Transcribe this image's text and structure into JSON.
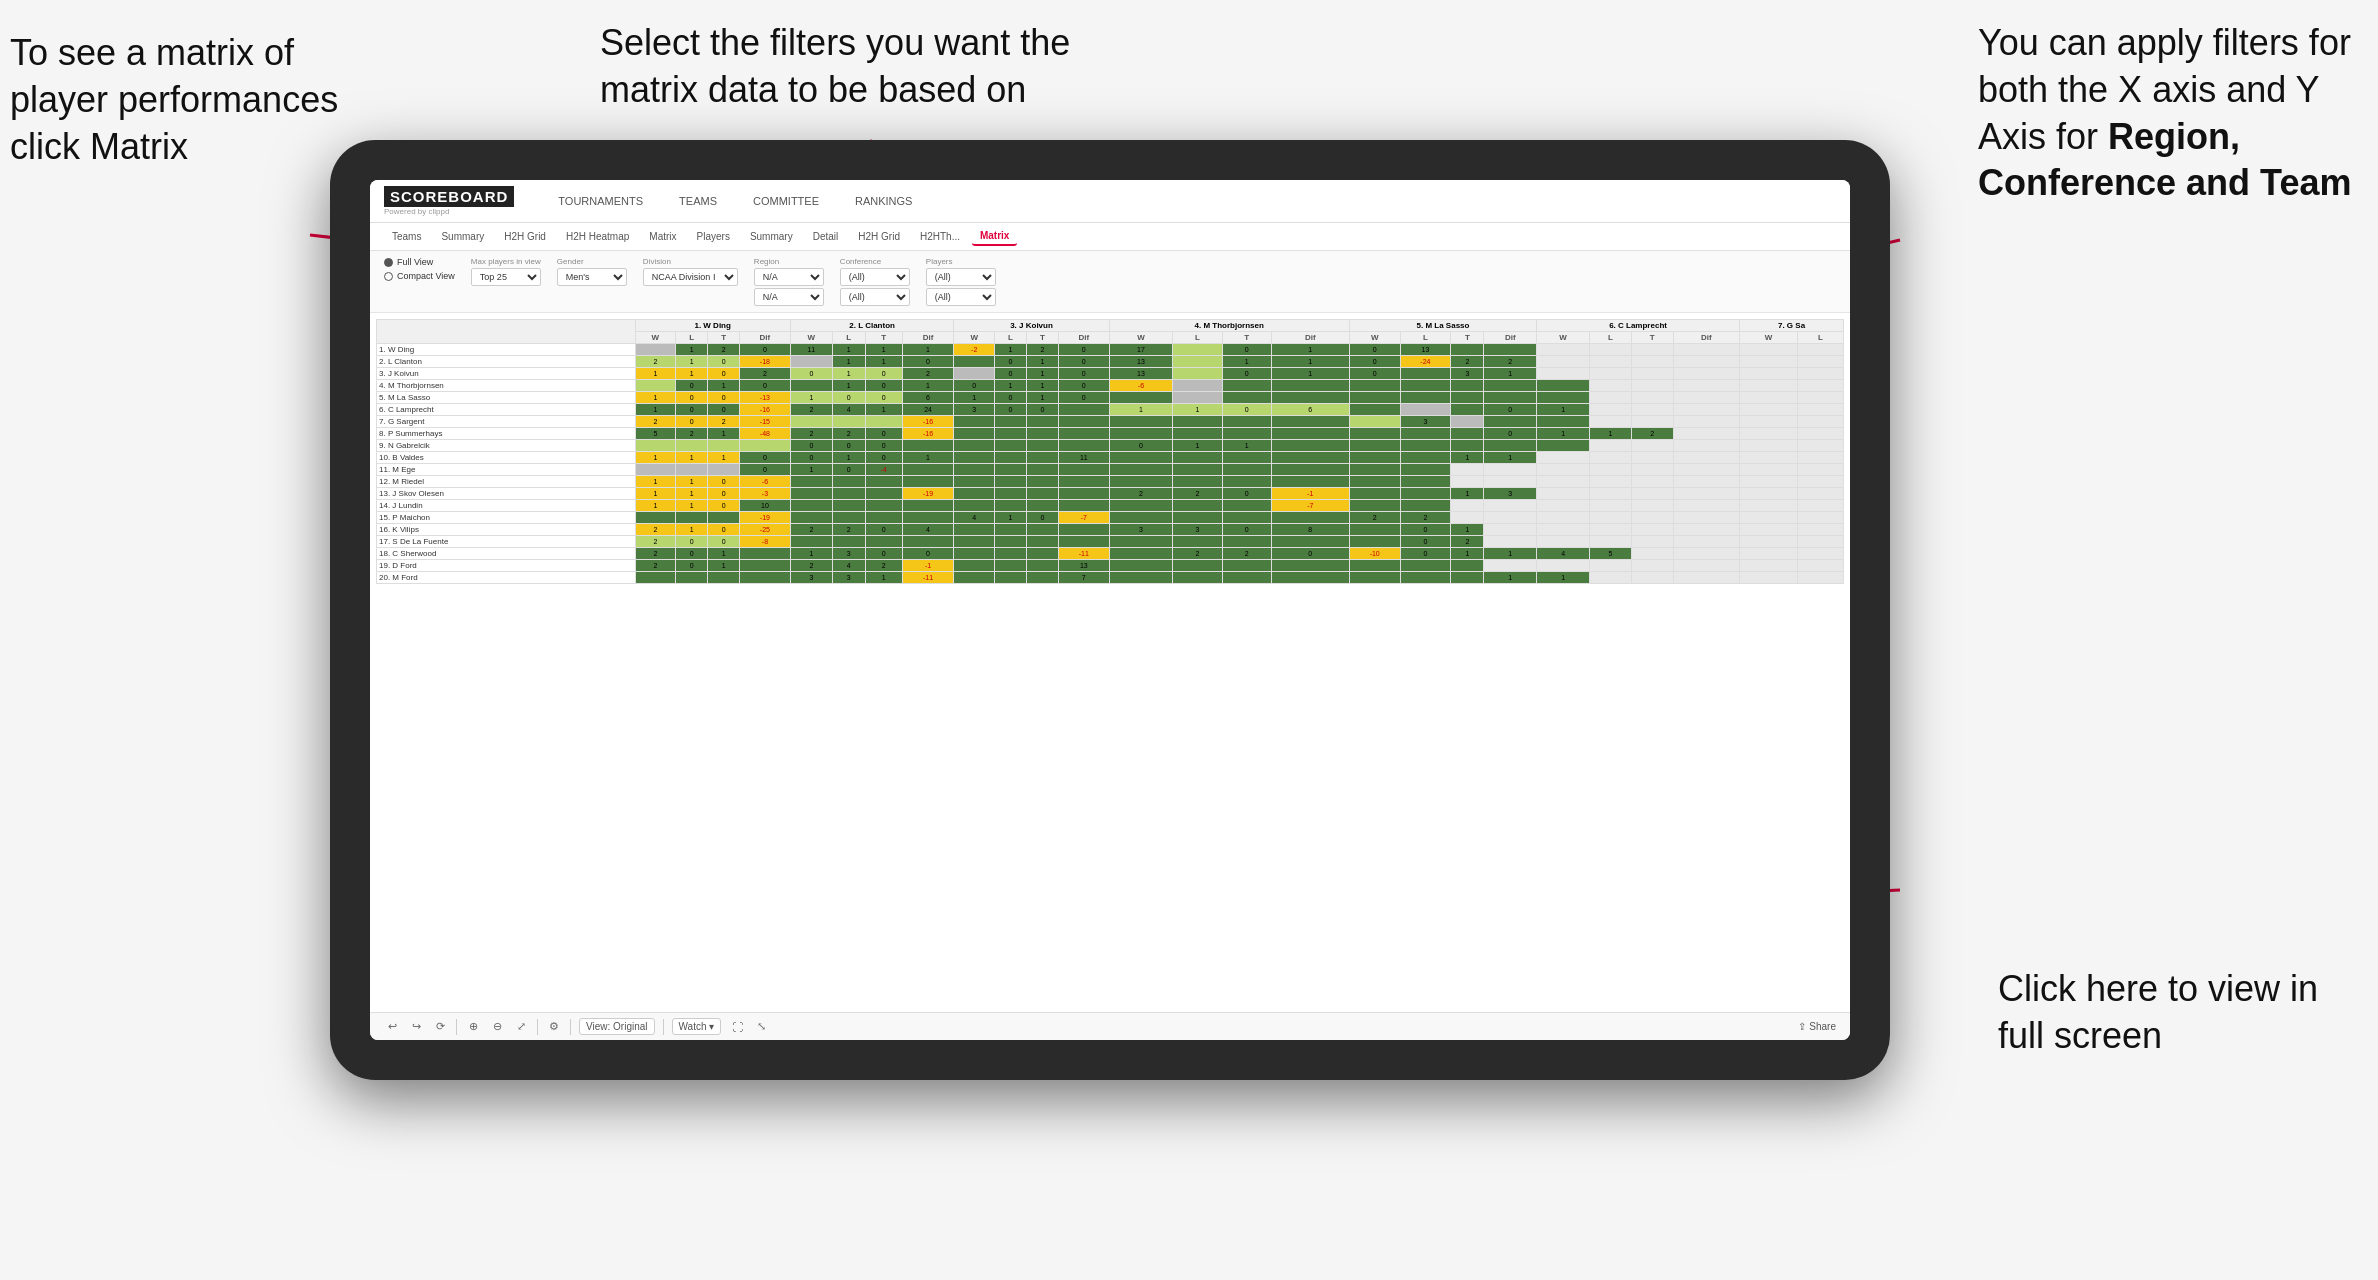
{
  "annotations": {
    "topleft": "To see a matrix of player performances click Matrix",
    "topleft_bold": "Matrix",
    "topmid": "Select the filters you want the matrix data to be based on",
    "topright_line1": "You  can apply filters for both the X axis and Y Axis for ",
    "topright_bold": "Region, Conference and Team",
    "bottomright": "Click here to view in full screen"
  },
  "nav": {
    "logo": "SCOREBOARD",
    "powered": "Powered by clippd",
    "items": [
      "TOURNAMENTS",
      "TEAMS",
      "COMMITTEE",
      "RANKINGS"
    ]
  },
  "subnav": {
    "tabs": [
      "Teams",
      "Summary",
      "H2H Grid",
      "H2H Heatmap",
      "Matrix",
      "Players",
      "Summary",
      "Detail",
      "H2H Grid",
      "H2HTh...",
      "Matrix"
    ]
  },
  "filters": {
    "view_full": "Full View",
    "view_compact": "Compact View",
    "max_players_label": "Max players in view",
    "max_players_value": "Top 25",
    "gender_label": "Gender",
    "gender_value": "Men's",
    "division_label": "Division",
    "division_value": "NCAA Division I",
    "region_label": "Region",
    "region_value": "N/A",
    "region_value2": "N/A",
    "conference_label": "Conference",
    "conference_value": "(All)",
    "conference_value2": "(All)",
    "players_label": "Players",
    "players_value": "(All)",
    "players_value2": "(All)"
  },
  "matrix": {
    "col_headers": [
      "1. W Ding",
      "2. L Clanton",
      "3. J Koivun",
      "4. M Thorbjornsen",
      "5. M La Sasso",
      "6. C Lamprecht",
      "7. G Sa"
    ],
    "sub_cols": [
      "W",
      "L",
      "T",
      "Dif"
    ],
    "rows": [
      {
        "name": "1. W Ding",
        "cells": [
          [
            1,
            2,
            0,
            11
          ],
          [],
          [],
          [],
          [],
          [],
          []
        ]
      },
      {
        "name": "2. L Clanton",
        "cells": [
          [
            2,
            1,
            0,
            -18
          ],
          [],
          [],
          [],
          [],
          [],
          []
        ]
      },
      {
        "name": "3. J Koivun",
        "cells": [
          [],
          [],
          [],
          [],
          [],
          [],
          []
        ]
      },
      {
        "name": "4. M Thorbjornsen",
        "cells": [
          [],
          [],
          [],
          [],
          [],
          [],
          []
        ]
      },
      {
        "name": "5. M La Sasso",
        "cells": [
          [],
          [],
          [],
          [],
          [],
          [],
          []
        ]
      },
      {
        "name": "6. C Lamprecht",
        "cells": [
          [],
          [],
          [],
          [],
          [],
          [],
          []
        ]
      },
      {
        "name": "7. G Sargent",
        "cells": [
          [],
          [],
          [],
          [],
          [],
          [],
          []
        ]
      },
      {
        "name": "8. P Summerhays",
        "cells": [
          [],
          [],
          [],
          [],
          [],
          [],
          []
        ]
      },
      {
        "name": "9. N Gabrelcik",
        "cells": [
          [],
          [],
          [],
          [],
          [],
          [],
          []
        ]
      },
      {
        "name": "10. B Valdes",
        "cells": [
          [],
          [],
          [],
          [],
          [],
          [],
          []
        ]
      },
      {
        "name": "11. M Ege",
        "cells": [
          [],
          [],
          [],
          [],
          [],
          [],
          []
        ]
      },
      {
        "name": "12. M Riedel",
        "cells": [
          [],
          [],
          [],
          [],
          [],
          [],
          []
        ]
      },
      {
        "name": "13. J Skov Olesen",
        "cells": [
          [],
          [],
          [],
          [],
          [],
          [],
          []
        ]
      },
      {
        "name": "14. J Lundin",
        "cells": [
          [],
          [],
          [],
          [],
          [],
          [],
          []
        ]
      },
      {
        "name": "15. P Maichon",
        "cells": [
          [],
          [],
          [],
          [],
          [],
          [],
          []
        ]
      },
      {
        "name": "16. K Vilips",
        "cells": [
          [],
          [],
          [],
          [],
          [],
          [],
          []
        ]
      },
      {
        "name": "17. S De La Fuente",
        "cells": [
          [],
          [],
          [],
          [],
          [],
          [],
          []
        ]
      },
      {
        "name": "18. C Sherwood",
        "cells": [
          [],
          [],
          [],
          [],
          [],
          [],
          []
        ]
      },
      {
        "name": "19. D Ford",
        "cells": [
          [],
          [],
          [],
          [],
          [],
          [],
          []
        ]
      },
      {
        "name": "20. M Ford",
        "cells": [
          [],
          [],
          [],
          [],
          [],
          [],
          []
        ]
      }
    ]
  },
  "toolbar": {
    "view_label": "View: Original",
    "watch_label": "Watch",
    "share_label": "Share"
  }
}
